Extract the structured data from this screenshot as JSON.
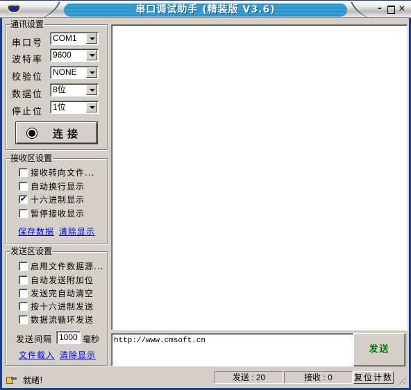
{
  "window": {
    "title": "串口调试助手 (精装版 V3.6)",
    "controls": {
      "minimize": "-",
      "maximize": "□",
      "close": "×"
    }
  },
  "comm_settings": {
    "title": "通讯设置",
    "fields": [
      {
        "label": "串口号",
        "value": "COM1"
      },
      {
        "label": "波特率",
        "value": "9600"
      },
      {
        "label": "校验位",
        "value": "NONE"
      },
      {
        "label": "数据位",
        "value": "8位"
      },
      {
        "label": "停止位",
        "value": "1位"
      }
    ],
    "connect_label": "连接",
    "connect_icon": "record-icon"
  },
  "receive_settings": {
    "title": "接收区设置",
    "options": [
      {
        "label": "接收转向文件...",
        "checked": false
      },
      {
        "label": "自动换行显示",
        "checked": false
      },
      {
        "label": "十六进制显示",
        "checked": true
      },
      {
        "label": "暂停接收显示",
        "checked": false
      }
    ],
    "save_link": "保存数据",
    "clear_link": "清除显示"
  },
  "send_settings": {
    "title": "发送区设置",
    "options": [
      {
        "label": "启用文件数据源...",
        "checked": false
      },
      {
        "label": "自动发送附加位",
        "checked": false
      },
      {
        "label": "发送完自动清空",
        "checked": false
      },
      {
        "label": "按十六进制发送",
        "checked": false
      },
      {
        "label": "数据流循环发送",
        "checked": false
      }
    ],
    "interval_label": "发送间隔",
    "interval_value": "1000",
    "interval_unit": "毫秒",
    "load_link": "文件载入",
    "clear_link": "清除显示"
  },
  "receive_area": {
    "content": ""
  },
  "send_area": {
    "content": "http://www.cmsoft.cn"
  },
  "send_button": {
    "label": "发送",
    "color": "#007a00"
  },
  "status_bar": {
    "status_text": "就绪!",
    "send_count": "发送 : 20",
    "recv_count": "接收 : 0",
    "reset_label": "复位计数"
  }
}
